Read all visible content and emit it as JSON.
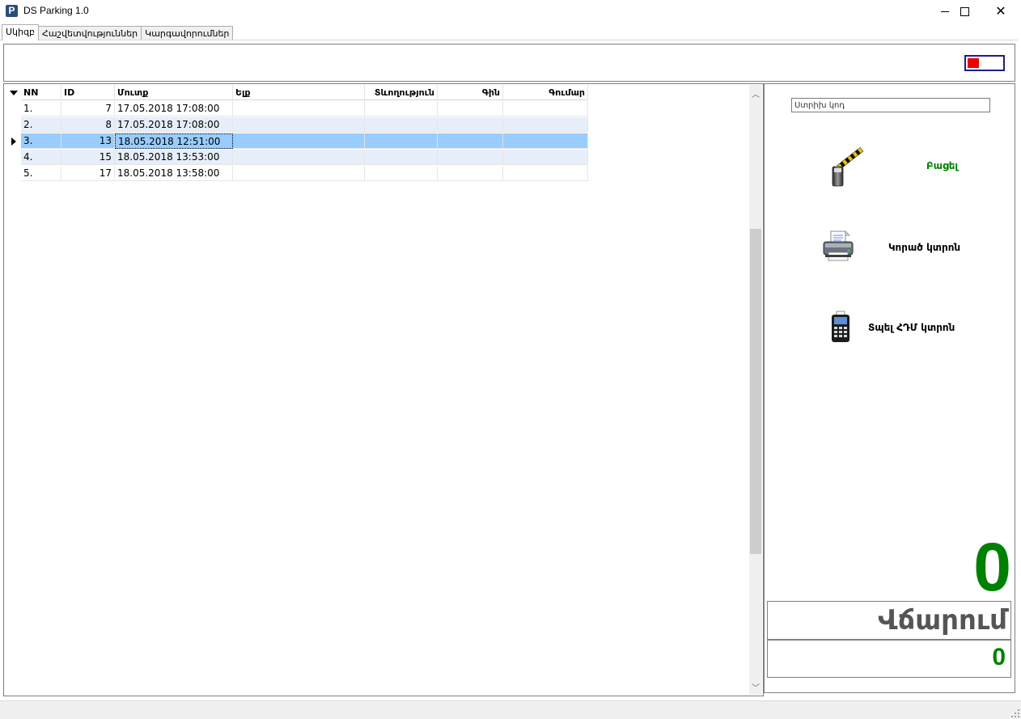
{
  "window": {
    "title": "DS Parking 1.0",
    "icon_letter": "P"
  },
  "tabs": [
    {
      "label": "Սկիզբ",
      "active": true
    },
    {
      "label": "Հաշվետվություններ",
      "active": false
    },
    {
      "label": "Կարգավորումներ",
      "active": false
    }
  ],
  "grid": {
    "columns": [
      "NN",
      "ID",
      "Մուտք",
      "Ելք",
      "Տևողություն",
      "Գին",
      "Գումար"
    ],
    "rows": [
      {
        "nn": "1.",
        "id": "7",
        "in": "17.05.2018 17:08:00",
        "out": "",
        "dur": "",
        "price": "",
        "sum": ""
      },
      {
        "nn": "2.",
        "id": "8",
        "in": "17.05.2018 17:08:00",
        "out": "",
        "dur": "",
        "price": "",
        "sum": ""
      },
      {
        "nn": "3.",
        "id": "13",
        "in": "18.05.2018 12:51:00",
        "out": "",
        "dur": "",
        "price": "",
        "sum": ""
      },
      {
        "nn": "4.",
        "id": "15",
        "in": "18.05.2018 13:53:00",
        "out": "",
        "dur": "",
        "price": "",
        "sum": ""
      },
      {
        "nn": "5.",
        "id": "17",
        "in": "18.05.2018 13:58:00",
        "out": "",
        "dur": "",
        "price": "",
        "sum": ""
      }
    ],
    "selected_row": 3
  },
  "side": {
    "code_placeholder": "Ստրիխ կոդ",
    "open_label": "Բացել",
    "printed_ticket_label": "Կորած կտրոն",
    "print_fiscal_label": "Տպել ՀԴՄ կտրոն",
    "count": "0",
    "payment_label": "Վճարում",
    "amount": "0"
  },
  "colors": {
    "accent_green": "#008000",
    "selection_blue": "#99ccff",
    "alt_row": "#e6eef9",
    "indicator_red": "#ee0000",
    "indicator_border": "#1a1f8a"
  },
  "icons": [
    "barrier-gate-icon",
    "printer-icon",
    "pos-terminal-icon",
    "minimize-icon",
    "maximize-icon",
    "close-icon"
  ]
}
